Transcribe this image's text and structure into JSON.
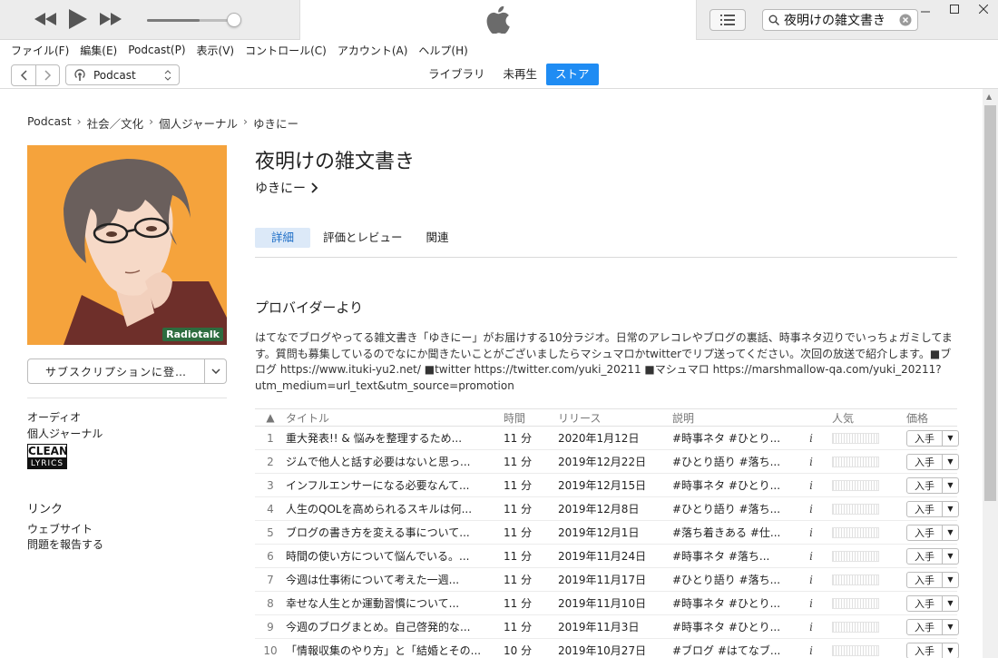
{
  "window": {
    "search_value": "夜明けの雑文書き",
    "volume_level": 0.6
  },
  "menu": [
    "ファイル(F)",
    "編集(E)",
    "Podcast(P)",
    "表示(V)",
    "コントロール(C)",
    "アカウント(A)",
    "ヘルプ(H)"
  ],
  "toolbar": {
    "source": "Podcast",
    "tabs": [
      "ライブラリ",
      "未再生",
      "ストア"
    ],
    "active_tab": "ストア"
  },
  "breadcrumb": [
    "Podcast",
    "社会／文化",
    "個人ジャーナル",
    "ゆきにー"
  ],
  "podcast": {
    "title": "夜明けの雑文書き",
    "author": "ゆきにー",
    "artwork_badge": "Radiotalk",
    "subscribe_label": "サブスクリプションに登…",
    "type": "オーディオ",
    "genre": "個人ジャーナル",
    "rating_top": "CLEAN",
    "rating_bottom": "LYRICS"
  },
  "links": {
    "title": "リンク",
    "items": [
      "ウェブサイト",
      "問題を報告する"
    ]
  },
  "detail_tabs": [
    "詳細",
    "評価とレビュー",
    "関連"
  ],
  "provider": {
    "title": "プロバイダーより",
    "description": "はてなでブログやってる雑文書き「ゆきにー」がお届けする10分ラジオ。日常のアレコレやブログの裏話、時事ネタ辺りでいっちょガミしてます。質問も募集しているのでなにか聞きたいことがございましたらマシュマロかtwitterでリプ送ってください。次回の放送で紹介します。■ブログ https://www.ituki-yu2.net/ ■twitter https://twitter.com/yuki_20211 ■マシュマロ https://marshmallow-qa.com/yuki_20211?utm_medium=url_text&utm_source=promotion"
  },
  "episodes": {
    "headers": [
      "▲",
      "タイトル",
      "時間",
      "リリース",
      "説明",
      "人気",
      "価格"
    ],
    "get_label": "入手",
    "rows": [
      {
        "num": "1",
        "title": "重大発表!! & 悩みを整理するため...",
        "time": "11 分",
        "release": "2020年1月12日",
        "desc": "#時事ネタ #ひとり..."
      },
      {
        "num": "2",
        "title": "ジムで他人と話す必要はないと思っ...",
        "time": "11 分",
        "release": "2019年12月22日",
        "desc": "#ひとり語り #落ち..."
      },
      {
        "num": "3",
        "title": "インフルエンサーになる必要なんて...",
        "time": "11 分",
        "release": "2019年12月15日",
        "desc": "#時事ネタ #ひとり..."
      },
      {
        "num": "4",
        "title": "人生のQOLを高められるスキルは何...",
        "time": "11 分",
        "release": "2019年12月8日",
        "desc": "#ひとり語り #落ち..."
      },
      {
        "num": "5",
        "title": "ブログの書き方を変える事について...",
        "time": "11 分",
        "release": "2019年12月1日",
        "desc": "#落ち着きある #仕..."
      },
      {
        "num": "6",
        "title": "時間の使い方について悩んでいる。...",
        "time": "11 分",
        "release": "2019年11月24日",
        "desc": "#時事ネタ #落ち..."
      },
      {
        "num": "7",
        "title": "今週は仕事術について考えた一週...",
        "time": "11 分",
        "release": "2019年11月17日",
        "desc": "#ひとり語り #落ち..."
      },
      {
        "num": "8",
        "title": "幸せな人生とか運動習慣について...",
        "time": "11 分",
        "release": "2019年11月10日",
        "desc": "#時事ネタ #ひとり..."
      },
      {
        "num": "9",
        "title": "今週のブログまとめ。自己啓発的な...",
        "time": "11 分",
        "release": "2019年11月3日",
        "desc": "#時事ネタ #ひとり..."
      },
      {
        "num": "10",
        "title": "「情報収集のやり方」と「結婚とその...",
        "time": "10 分",
        "release": "2019年10月27日",
        "desc": "#ブログ #はてなブ..."
      }
    ]
  }
}
